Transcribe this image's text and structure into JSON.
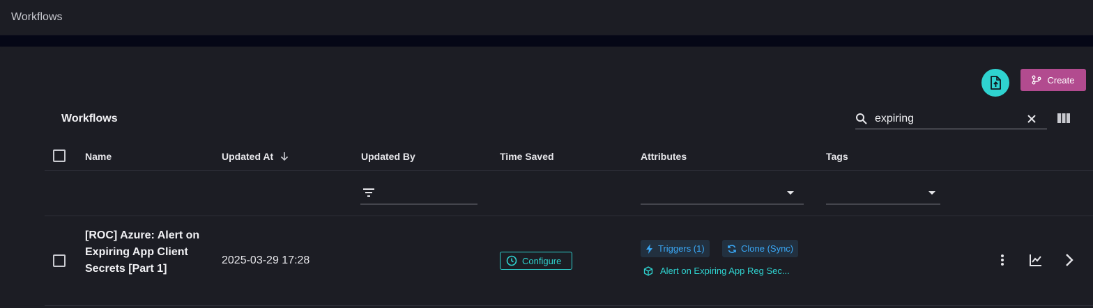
{
  "topbar": {
    "title": "Workflows"
  },
  "toolbar": {
    "upload_icon": "file-upload-icon",
    "create_label": "Create",
    "create_icon": "branch-icon"
  },
  "section": {
    "title": "Workflows"
  },
  "search": {
    "value": "expiring",
    "icon": "search-icon",
    "clear_icon": "close-icon"
  },
  "columns": {
    "name": "Name",
    "updated_at": "Updated At",
    "updated_by": "Updated By",
    "time_saved": "Time Saved",
    "attributes": "Attributes",
    "tags": "Tags"
  },
  "sort": {
    "column": "updated_at",
    "direction": "descending"
  },
  "rows": [
    {
      "name": "[ROC] Azure: Alert on Expiring App Client Secrets [Part 1]",
      "updated_at": "2025-03-29 17:28",
      "time_saved_button": "Configure",
      "chips": [
        "Triggers (1)",
        "Clone (Sync)"
      ],
      "linked_workflow": "Alert on Expiring App Reg Sec..."
    }
  ],
  "colors": {
    "accent_teal": "#2fd3d0",
    "create_magenta": "#b24b8f",
    "chip_blue": "#3aa7f5",
    "background": "#1c1d24"
  }
}
